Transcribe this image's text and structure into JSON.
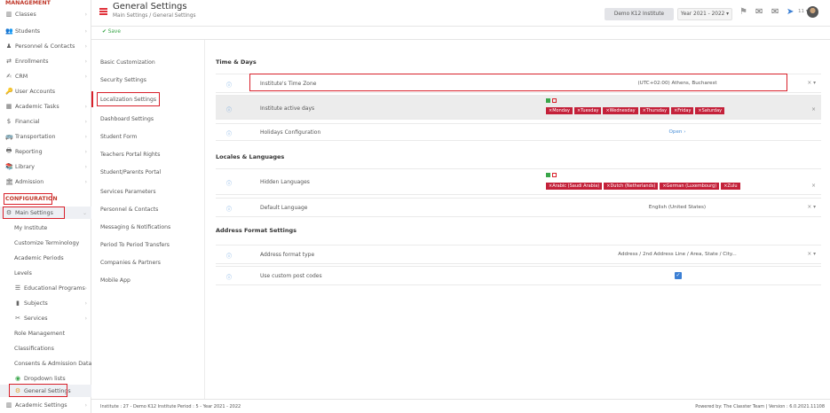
{
  "sidebar": {
    "management_header": "MANAGEMENT",
    "configuration_header": "CONFIGURATION",
    "items": [
      {
        "label": "Classes",
        "icon": "classes-icon"
      },
      {
        "label": "Students",
        "icon": "students-icon"
      },
      {
        "label": "Personnel & Contacts",
        "icon": "personnel-icon"
      },
      {
        "label": "Enrollments",
        "icon": "enrollments-icon"
      },
      {
        "label": "CRM",
        "icon": "crm-icon"
      },
      {
        "label": "User Accounts",
        "icon": "user-accounts-icon"
      },
      {
        "label": "Academic Tasks",
        "icon": "academic-tasks-icon"
      },
      {
        "label": "Financial",
        "icon": "financial-icon"
      },
      {
        "label": "Transportation",
        "icon": "transportation-icon"
      },
      {
        "label": "Reporting",
        "icon": "reporting-icon"
      },
      {
        "label": "Library",
        "icon": "library-icon"
      },
      {
        "label": "Admission",
        "icon": "admission-icon"
      }
    ],
    "main_settings": "Main Settings",
    "sub_items": [
      "My Institute",
      "Customize Terminology",
      "Academic Periods",
      "Levels",
      "Educational Programs",
      "Subjects",
      "Services",
      "Role Management",
      "Classifications",
      "Consents & Admission Data",
      "Dropdown lists",
      "General Settings"
    ],
    "academic_settings": "Academic Settings"
  },
  "header": {
    "title": "General Settings",
    "breadcrumb": "Main Settings  /  General Settings",
    "institute": "Demo K12 Institute",
    "year": "Year 2021 - 2022  ▾",
    "user_count": "11 ▾"
  },
  "toolbar": {
    "save_label": "Save"
  },
  "settings_menu": [
    "Basic Customization",
    "Security Settings",
    "Localization Settings",
    "Dashboard Settings",
    "Student Form",
    "Teachers Portal Rights",
    "Student/Parents Portal",
    "Services Parameters",
    "Personnel & Contacts",
    "Messaging & Notifications",
    "Period To Period Transfers",
    "Companies & Partners",
    "Mobile App"
  ],
  "sections": {
    "time_days": "Time & Days",
    "locales": "Locales & Languages",
    "address": "Address Format Settings"
  },
  "rows": {
    "timezone": {
      "label": "Institute's Time Zone",
      "value": "(UTC+02:00) Athens, Bucharest"
    },
    "active_days": {
      "label": "Institute active days",
      "tags": [
        "×Monday",
        "×Tuesday",
        "×Wednesday",
        "×Thursday",
        "×Friday",
        "×Saturday"
      ]
    },
    "holidays": {
      "label": "Holidays Configuration",
      "value": "Open ›"
    },
    "hidden_languages": {
      "label": "Hidden Languages",
      "tags": [
        "×Arabic (Saudi Arabia)",
        "×Dutch (Netherlands)",
        "×German (Luxembourg)",
        "×Zulu"
      ]
    },
    "default_language": {
      "label": "Default Language",
      "value": "English (United States)"
    },
    "address_format": {
      "label": "Address format type",
      "value": "Address / 2nd Address Line / Area, State / City..."
    },
    "custom_post": {
      "label": "Use custom post codes"
    }
  },
  "footer": {
    "left": "Institute : 27 - Demo K12 Institute  Period : 5 - Year 2021 - 2022",
    "right": "Powered by: The Classter Team  |  Version : 6.0.2021.11108"
  },
  "colors": {
    "accent": "#d8202a",
    "tag": "#c4213a",
    "link": "#4a90d9",
    "save": "#3aa64a"
  }
}
